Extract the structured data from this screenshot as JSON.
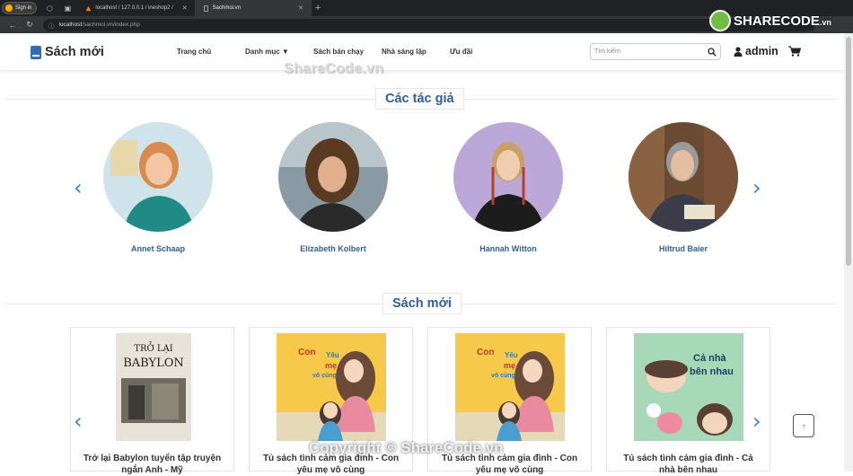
{
  "browser": {
    "signin": "Sign in",
    "tabs": [
      {
        "label": "localhost / 127.0.0.1 / ineshop2 /"
      },
      {
        "label": "Sachmoi.vn"
      }
    ],
    "url_host": "localhost",
    "url_path": "/sachmoi.vn/index.php"
  },
  "header": {
    "brand": "Sách mới",
    "menu": [
      "Trang chủ",
      "Danh mục ▼",
      "Sách bán chạy",
      "Nhà sáng lập",
      "Ưu đãi"
    ],
    "search_placeholder": "Tìm kiếm",
    "user": "admin"
  },
  "watermarks": {
    "logo_main": "SHARECODE",
    "logo_suffix": ".vn",
    "mid": "ShareCode.vn",
    "bottom": "Copyright © ShareCode.vn"
  },
  "authors_section": {
    "title": "Các tác giả",
    "authors": [
      {
        "name": "Annet Schaap"
      },
      {
        "name": "Elizabeth Kolbert"
      },
      {
        "name": "Hannah Witton"
      },
      {
        "name": "Hiltrud Baier"
      }
    ]
  },
  "books_section": {
    "title": "Sách mới",
    "books": [
      {
        "title": "Trở lại Babylon tuyển tập truyện ngắn Anh - Mỹ",
        "cover_text": [
          "TRỞ LẠI",
          "BABYLON"
        ]
      },
      {
        "title": "Tủ sách tình cảm gia đình - Con yêu mẹ vô cùng",
        "cover_text": [
          "Con",
          "Yêu",
          "mẹ",
          "vô cùng"
        ]
      },
      {
        "title": "Tủ sách tình cảm gia đình - Con yêu mẹ vô cùng",
        "cover_text": [
          "Con",
          "Yêu",
          "mẹ",
          "vô cùng"
        ]
      },
      {
        "title": "Tủ sách tình cảm gia đình - Cả nhà bên nhau",
        "cover_text": [
          "Cả nhà",
          "bên nhau"
        ]
      }
    ]
  },
  "back_to_top": "↑"
}
